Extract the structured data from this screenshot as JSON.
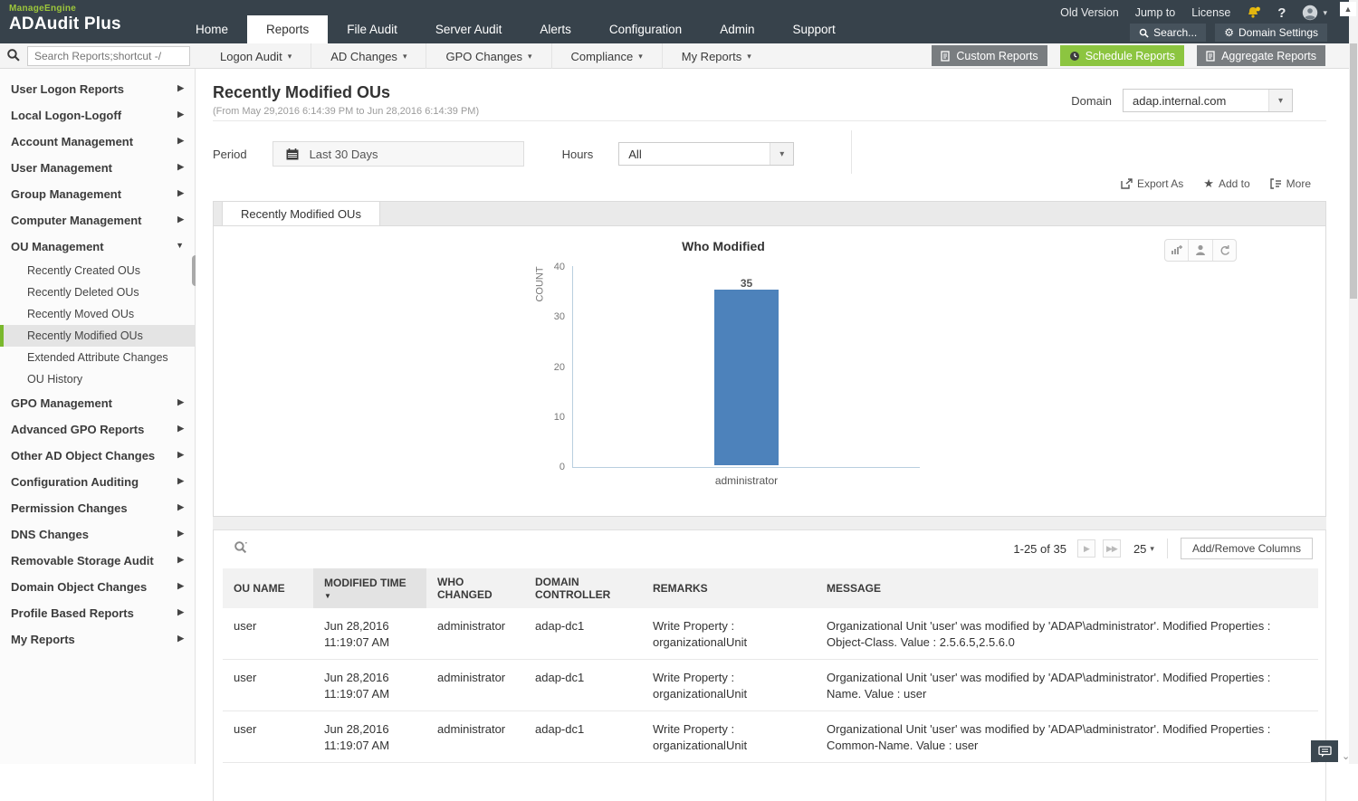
{
  "header": {
    "brand": "ManageEngine",
    "product": "ADAudit Plus",
    "nav_tabs": [
      {
        "label": "Home"
      },
      {
        "label": "Reports"
      },
      {
        "label": "File Audit"
      },
      {
        "label": "Server Audit"
      },
      {
        "label": "Alerts"
      },
      {
        "label": "Configuration"
      },
      {
        "label": "Admin"
      },
      {
        "label": "Support"
      }
    ],
    "utility": {
      "old_version": "Old Version",
      "jump_to": "Jump to",
      "license": "License",
      "help": "?"
    },
    "search_button": "Search...",
    "domain_settings_button": "Domain Settings"
  },
  "subheader": {
    "search_placeholder": "Search Reports;shortcut -/",
    "menus": [
      "Logon Audit",
      "AD Changes",
      "GPO Changes",
      "Compliance",
      "My Reports"
    ],
    "buttons": {
      "custom": "Custom Reports",
      "schedule": "Schedule Reports",
      "aggregate": "Aggregate Reports"
    }
  },
  "sidebar": {
    "items_top": [
      "User Logon Reports",
      "Local Logon-Logoff",
      "Account Management",
      "User Management",
      "Group Management",
      "Computer Management"
    ],
    "ou_section": {
      "label": "OU Management",
      "children": [
        "Recently Created OUs",
        "Recently Deleted OUs",
        "Recently Moved OUs",
        "Recently Modified OUs",
        "Extended Attribute Changes",
        "OU History"
      ],
      "active_child": "Recently Modified OUs"
    },
    "items_bottom": [
      "GPO Management",
      "Advanced GPO Reports",
      "Other AD Object Changes",
      "Configuration Auditing",
      "Permission Changes",
      "DNS Changes",
      "Removable Storage Audit",
      "Domain Object Changes",
      "Profile Based Reports",
      "My Reports"
    ]
  },
  "page": {
    "title": "Recently Modified OUs",
    "date_range": "(From May 29,2016 6:14:39 PM to Jun 28,2016 6:14:39 PM)",
    "domain_label": "Domain",
    "domain_value": "adap.internal.com",
    "period_label": "Period",
    "period_value": "Last 30 Days",
    "hours_label": "Hours",
    "hours_value": "All",
    "actions": {
      "export": "Export As",
      "add_to": "Add to",
      "more": "More"
    },
    "tab": "Recently Modified OUs"
  },
  "chart_data": {
    "type": "bar",
    "title": "Who Modified",
    "categories": [
      "administrator"
    ],
    "values": [
      35
    ],
    "ylabel": "COUNT",
    "xlabel": "",
    "yticks": [
      0,
      10,
      20,
      30,
      40
    ],
    "ylim": [
      0,
      40
    ],
    "bar_color": "#4d82bb",
    "grid": false,
    "legend": "none"
  },
  "table": {
    "pagination": {
      "range": "1-25 of 35",
      "page_size": "25",
      "columns_button": "Add/Remove Columns"
    },
    "headers": [
      "OU NAME",
      "MODIFIED TIME",
      "WHO CHANGED",
      "DOMAIN CONTROLLER",
      "REMARKS",
      "MESSAGE"
    ],
    "sorted_column": "MODIFIED TIME",
    "rows": [
      {
        "ou_name": "user",
        "modified_time": "Jun 28,2016 11:19:07 AM",
        "who_changed": "administrator",
        "domain_controller": "adap-dc1",
        "remarks": "Write Property : organizationalUnit",
        "message": "Organizational Unit 'user' was modified by 'ADAP\\administrator'. Modified Properties : Object-Class. Value : 2.5.6.5,2.5.6.0"
      },
      {
        "ou_name": "user",
        "modified_time": "Jun 28,2016 11:19:07 AM",
        "who_changed": "administrator",
        "domain_controller": "adap-dc1",
        "remarks": "Write Property : organizationalUnit",
        "message": "Organizational Unit 'user' was modified by 'ADAP\\administrator'. Modified Properties : Name. Value : user"
      },
      {
        "ou_name": "user",
        "modified_time": "Jun 28,2016 11:19:07 AM",
        "who_changed": "administrator",
        "domain_controller": "adap-dc1",
        "remarks": "Write Property : organizationalUnit",
        "message": "Organizational Unit 'user' was modified by 'ADAP\\administrator'. Modified Properties : Common-Name. Value : user"
      }
    ]
  }
}
